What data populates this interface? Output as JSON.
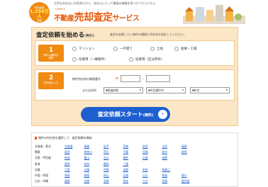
{
  "header": {
    "badge_line1": "利用者数",
    "badge_count": "1,259万人",
    "badge_line2": "突破",
    "tagline": "大切なお住まいの売却だから、あなたにとって最高の価格を見つけてもらいたい",
    "logo_small": "HOME'S",
    "logo_prefix": "不動産",
    "logo_main": "売却査定",
    "logo_suffix": "サービス"
  },
  "form": {
    "title": "査定依頼を始める",
    "title_free": "(無料)",
    "note": "査定を依頼したい物件の種類と所在地を指定してください。",
    "step1": {
      "num": "1",
      "label1": "物件の種別を",
      "label2": "選択"
    },
    "step2": {
      "num": "2",
      "label1": "所在地を入力",
      "label2": ""
    },
    "types": [
      "マンション",
      "一戸建て",
      "土地",
      "倉庫・工場",
      "投資用（一棟物件）",
      "投資用（区分所有）"
    ],
    "zip_label": "物件所在地の郵便番号",
    "zip_mark": "〒",
    "zip_sep": "-",
    "or_label": "または住所",
    "pref_select": "▼都道府県",
    "city_select": "▼市区郡町村",
    "town_select": "▼町名",
    "cta_label": "査定依頼スタート",
    "cta_free": "(無料)",
    "cta_arrow": "›"
  },
  "areas": {
    "title": "物件の所在地を選択して、査定依頼を開始",
    "regions": [
      {
        "name": "北海道・東北",
        "prefs": [
          "北海道",
          "青森",
          "岩手",
          "宮城",
          "秋田",
          "山形",
          "福島"
        ]
      },
      {
        "name": "関東",
        "prefs": [
          "東京",
          "神奈川",
          "埼玉",
          "千葉",
          "茨城",
          "栃木",
          "群馬"
        ]
      },
      {
        "name": "北陸・甲信越",
        "prefs": [
          "新潟",
          "富山",
          "石川",
          "福井",
          "山梨",
          "長野"
        ]
      },
      {
        "name": "東海",
        "prefs": [
          "愛知",
          "岐阜",
          "静岡",
          "三重"
        ]
      },
      {
        "name": "近畿",
        "prefs": [
          "大阪",
          "兵庫",
          "京都",
          "滋賀",
          "奈良",
          "和歌山"
        ]
      },
      {
        "name": "中国・四国",
        "prefs": [
          "鳥取",
          "島根",
          "岡山",
          "広島",
          "山口",
          "徳島",
          "香川"
        ]
      },
      {
        "name": "九州・沖縄",
        "prefs": [
          "福岡",
          "佐賀",
          "長崎",
          "熊本",
          "大分",
          "宮崎",
          "鹿児島"
        ]
      }
    ]
  }
}
